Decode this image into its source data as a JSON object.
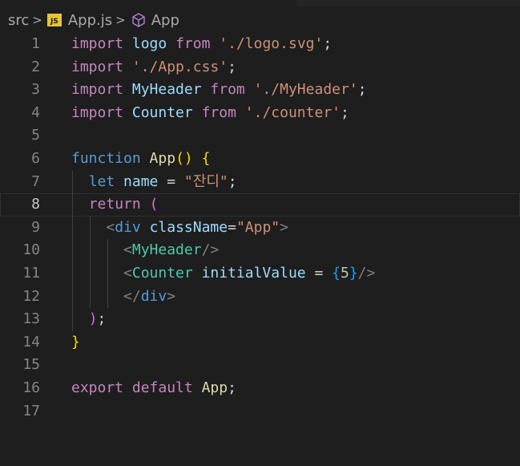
{
  "breadcrumb": {
    "folder": "src",
    "file": "App.js",
    "file_icon": "JS",
    "symbol": "App",
    "separator": ">"
  },
  "colors": {
    "background": "#1e1e1e",
    "keyword_control": "#c586c0",
    "keyword": "#569cd6",
    "variable": "#9cdcfe",
    "function": "#dcdcaa",
    "string": "#ce9178",
    "component": "#4ec9b0",
    "number": "#b5cea8",
    "bracket_level1": "#ffd700",
    "bracket_level2": "#da70d6",
    "bracket_level3": "#179fff"
  },
  "active_line": 8,
  "lines": [
    {
      "n": "1",
      "code": [
        {
          "t": "import",
          "c": "k"
        },
        {
          "t": " ",
          "c": "p"
        },
        {
          "t": "logo",
          "c": "v"
        },
        {
          "t": " ",
          "c": "p"
        },
        {
          "t": "from",
          "c": "k"
        },
        {
          "t": " ",
          "c": "p"
        },
        {
          "t": "'./logo.svg'",
          "c": "s"
        },
        {
          "t": ";",
          "c": "p"
        }
      ]
    },
    {
      "n": "2",
      "code": [
        {
          "t": "import",
          "c": "k"
        },
        {
          "t": " ",
          "c": "p"
        },
        {
          "t": "'./App.css'",
          "c": "s"
        },
        {
          "t": ";",
          "c": "p"
        }
      ]
    },
    {
      "n": "3",
      "code": [
        {
          "t": "import",
          "c": "k"
        },
        {
          "t": " ",
          "c": "p"
        },
        {
          "t": "MyHeader",
          "c": "v"
        },
        {
          "t": " ",
          "c": "p"
        },
        {
          "t": "from",
          "c": "k"
        },
        {
          "t": " ",
          "c": "p"
        },
        {
          "t": "'./MyHeader'",
          "c": "s"
        },
        {
          "t": ";",
          "c": "p"
        }
      ]
    },
    {
      "n": "4",
      "code": [
        {
          "t": "import",
          "c": "k"
        },
        {
          "t": " ",
          "c": "p"
        },
        {
          "t": "Counter",
          "c": "v"
        },
        {
          "t": " ",
          "c": "p"
        },
        {
          "t": "from",
          "c": "k"
        },
        {
          "t": " ",
          "c": "p"
        },
        {
          "t": "'./counter'",
          "c": "s"
        },
        {
          "t": ";",
          "c": "p"
        }
      ]
    },
    {
      "n": "5",
      "code": []
    },
    {
      "n": "6",
      "code": [
        {
          "t": "function",
          "c": "kb"
        },
        {
          "t": " ",
          "c": "p"
        },
        {
          "t": "App",
          "c": "f"
        },
        {
          "t": "()",
          "c": "b1"
        },
        {
          "t": " ",
          "c": "p"
        },
        {
          "t": "{",
          "c": "b1"
        }
      ]
    },
    {
      "n": "7",
      "code": [
        {
          "t": "  ",
          "c": "p"
        },
        {
          "t": "let",
          "c": "kb"
        },
        {
          "t": " ",
          "c": "p"
        },
        {
          "t": "name",
          "c": "v"
        },
        {
          "t": " = ",
          "c": "p"
        },
        {
          "t": "\"잔디\"",
          "c": "s"
        },
        {
          "t": ";",
          "c": "p"
        }
      ]
    },
    {
      "n": "8",
      "code": [
        {
          "t": "  ",
          "c": "p"
        },
        {
          "t": "return",
          "c": "k"
        },
        {
          "t": " ",
          "c": "p"
        },
        {
          "t": "(",
          "c": "b2"
        }
      ]
    },
    {
      "n": "9",
      "code": [
        {
          "t": "    ",
          "c": "p"
        },
        {
          "t": "<",
          "c": "g"
        },
        {
          "t": "div",
          "c": "kb"
        },
        {
          "t": " ",
          "c": "p"
        },
        {
          "t": "className",
          "c": "v"
        },
        {
          "t": "=",
          "c": "p"
        },
        {
          "t": "\"App\"",
          "c": "s"
        },
        {
          "t": ">",
          "c": "g"
        }
      ]
    },
    {
      "n": "10",
      "code": [
        {
          "t": "      ",
          "c": "p"
        },
        {
          "t": "<",
          "c": "g"
        },
        {
          "t": "MyHeader",
          "c": "t"
        },
        {
          "t": "/>",
          "c": "g"
        }
      ]
    },
    {
      "n": "11",
      "code": [
        {
          "t": "      ",
          "c": "p"
        },
        {
          "t": "<",
          "c": "g"
        },
        {
          "t": "Counter",
          "c": "t"
        },
        {
          "t": " ",
          "c": "p"
        },
        {
          "t": "initialValue",
          "c": "v"
        },
        {
          "t": " = ",
          "c": "p"
        },
        {
          "t": "{",
          "c": "b3"
        },
        {
          "t": "5",
          "c": "n"
        },
        {
          "t": "}",
          "c": "b3"
        },
        {
          "t": "/>",
          "c": "g"
        }
      ]
    },
    {
      "n": "12",
      "code": [
        {
          "t": "      ",
          "c": "p"
        },
        {
          "t": "</",
          "c": "g"
        },
        {
          "t": "div",
          "c": "kb"
        },
        {
          "t": ">",
          "c": "g"
        }
      ]
    },
    {
      "n": "13",
      "code": [
        {
          "t": "  ",
          "c": "p"
        },
        {
          "t": ")",
          "c": "b2"
        },
        {
          "t": ";",
          "c": "p"
        }
      ]
    },
    {
      "n": "14",
      "code": [
        {
          "t": "}",
          "c": "b1"
        }
      ]
    },
    {
      "n": "15",
      "code": []
    },
    {
      "n": "16",
      "code": [
        {
          "t": "export",
          "c": "k"
        },
        {
          "t": " ",
          "c": "p"
        },
        {
          "t": "default",
          "c": "k"
        },
        {
          "t": " ",
          "c": "p"
        },
        {
          "t": "App",
          "c": "f"
        },
        {
          "t": ";",
          "c": "p"
        }
      ]
    },
    {
      "n": "17",
      "code": []
    }
  ]
}
